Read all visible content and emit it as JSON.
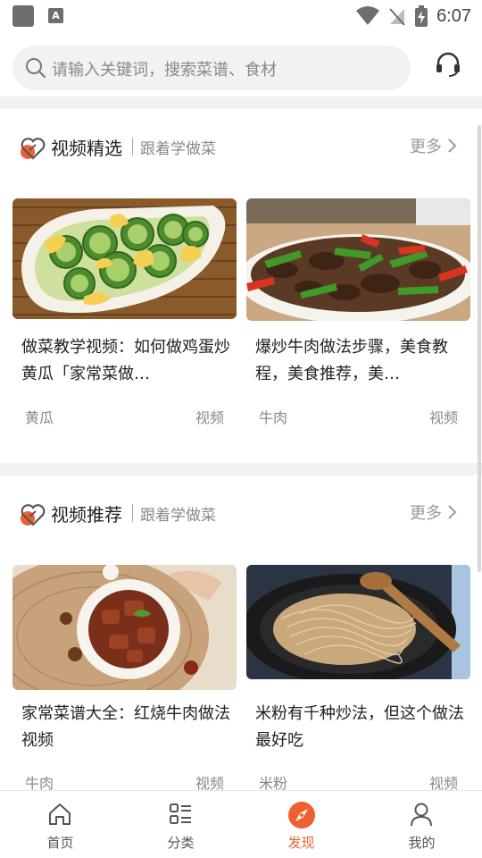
{
  "status_bar": {
    "time": "6:07",
    "app_icon_letter": "A"
  },
  "search": {
    "placeholder": "请输入关键词，搜索菜谱、食材"
  },
  "colors": {
    "accent": "#ee6030"
  },
  "sections": [
    {
      "title": "视频精选",
      "subtitle": "跟着学做菜",
      "more": "更多",
      "cards": [
        {
          "title": "做菜教学视频：如何做鸡蛋炒黄瓜「家常菜做…",
          "tag": "黄瓜",
          "type": "视频"
        },
        {
          "title": "爆炒牛肉做法步骤，美食教程，美食推荐，美…",
          "tag": "牛肉",
          "type": "视频"
        }
      ]
    },
    {
      "title": "视频推荐",
      "subtitle": "跟着学做菜",
      "more": "更多",
      "cards": [
        {
          "title": "家常菜谱大全：红烧牛肉做法视频",
          "tag": "牛肉",
          "type": "视频"
        },
        {
          "title": "米粉有千种炒法，但这个做法最好吃",
          "tag": "米粉",
          "type": "视频"
        }
      ]
    }
  ],
  "tabs": [
    {
      "label": "首页",
      "icon": "home-icon"
    },
    {
      "label": "分类",
      "icon": "category-list-icon"
    },
    {
      "label": "发现",
      "icon": "compass-icon",
      "active": true
    },
    {
      "label": "我的",
      "icon": "user-icon"
    }
  ]
}
